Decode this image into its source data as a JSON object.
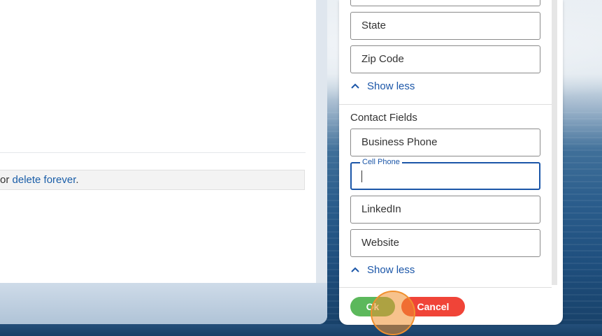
{
  "left_panel": {
    "notice_prefix": "or ",
    "notice_link": "delete forever",
    "notice_suffix": "."
  },
  "address_fields": {
    "state_placeholder": "State",
    "zip_placeholder": "Zip Code",
    "show_less": "Show less"
  },
  "contact_fields": {
    "title": "Contact Fields",
    "business_phone": "Business Phone",
    "cell_phone_label": "Cell Phone",
    "cell_phone_value": "",
    "linkedin": "LinkedIn",
    "website": "Website",
    "show_less": "Show less"
  },
  "actions": {
    "ok_label": "Ok",
    "cancel_label": "Cancel"
  },
  "colors": {
    "accent": "#1b56a8",
    "ok": "#5cb85c",
    "cancel": "#f04438"
  }
}
